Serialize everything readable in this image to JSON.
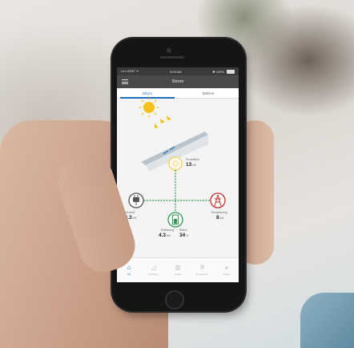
{
  "status_bar": {
    "carrier": "••••• AT&T  ᯤ",
    "time": "9:09 AM",
    "battery": "✱ 100%"
  },
  "app_bar": {
    "title": "Strom"
  },
  "tabs": [
    {
      "label": "Strom",
      "active": true
    },
    {
      "label": "Wärme",
      "active": false
    }
  ],
  "production": {
    "label": "Produktion",
    "value": "13",
    "unit": "kW"
  },
  "consumption": {
    "label": "Verbrauch",
    "value": "20.3",
    "unit": "kW"
  },
  "feed_in": {
    "label": "Einspeisung",
    "value": "8",
    "unit": "kW"
  },
  "battery": {
    "discharge_label": "Entladung",
    "discharge_value": "4.3",
    "discharge_unit": "kW",
    "level_label": "Stand",
    "level_value": "34",
    "level_unit": "%"
  },
  "bottom_nav": [
    {
      "label": "Übr",
      "icon": "home-icon",
      "active": true
    },
    {
      "label": "Flüchtling",
      "icon": "chart-icon",
      "active": false
    },
    {
      "label": "Verlauf",
      "icon": "bar-chart-icon",
      "active": false
    },
    {
      "label": "Systemeinst.",
      "icon": "gear-icon",
      "active": false
    },
    {
      "label": "Autark",
      "icon": "pie-icon",
      "active": false
    }
  ],
  "colors": {
    "accent": "#1e6fb8",
    "sun": "#f4c21a",
    "line_green": "#2e9a52",
    "feed_red": "#c62828"
  }
}
